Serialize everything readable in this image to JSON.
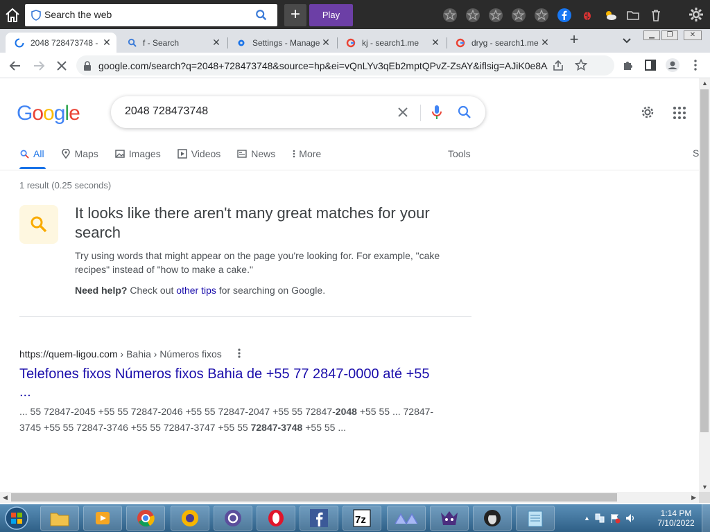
{
  "topbar": {
    "search_placeholder": "Search the web",
    "play_label": "Play",
    "new_label": "+"
  },
  "tabs": [
    {
      "title": "2048 728473748 -",
      "close": "✕",
      "favicon": "loading-spinner-icon",
      "active": true
    },
    {
      "title": "f - Search",
      "close": "✕",
      "favicon": "search-icon"
    },
    {
      "title": "Settings - Manage",
      "close": "✕",
      "favicon": "gear-icon"
    },
    {
      "title": "kj - search1.me",
      "close": "✕",
      "favicon": "google-icon"
    },
    {
      "title": "dryg - search1.me",
      "close": "✕",
      "favicon": "google-icon"
    }
  ],
  "address_bar": {
    "url": "google.com/search?q=2048+728473748&source=hp&ei=vQnLYv3qEb2mptQPvZ-ZsAY&iflsig=AJiK0e8AAA..."
  },
  "google": {
    "logo": [
      "G",
      "o",
      "o",
      "g",
      "l",
      "e"
    ],
    "logo_colors": [
      "#4285f4",
      "#ea4335",
      "#fbbc05",
      "#4285f4",
      "#34a853",
      "#ea4335"
    ],
    "query": "2048 728473748",
    "tabs": [
      {
        "label": "All",
        "icon": "search-icon"
      },
      {
        "label": "Maps",
        "icon": "map-pin-icon"
      },
      {
        "label": "Images",
        "icon": "image-icon"
      },
      {
        "label": "Videos",
        "icon": "video-icon"
      },
      {
        "label": "News",
        "icon": "news-icon"
      },
      {
        "label": "More",
        "icon": "more-vert-icon"
      }
    ],
    "tools_label": "Tools",
    "signin_edge": "S",
    "result_stats": "1 result (0.25 seconds)",
    "no_match": {
      "title": "It looks like there aren't many great matches for your search",
      "body": "Try using words that might appear on the page you're looking for. For example, \"cake recipes\" instead of \"how to make a cake.\"",
      "help_bold": "Need help?",
      "help_pre": " Check out ",
      "help_link": "other tips",
      "help_post": " for searching on Google."
    },
    "result": {
      "site": "https://quem-ligou.com",
      "breadcrumb": " › Bahia › Números fixos",
      "title": "Telefones fixos Números fixos Bahia de +55 77 2847-0000 até +55 ...",
      "snippet_1": "... 55 72847-2045 +55 55 72847-2046 +55 55 72847-2047 +55 55 72847-",
      "snippet_b1": "2048",
      "snippet_2": " +55 55 ... 72847-3745 +55 55 72847-3746 +55 55 72847-3747 +55 55 ",
      "snippet_b2": "72847-3748",
      "snippet_3": " +55 55 ..."
    }
  },
  "taskbar": {
    "clock_time": "1:14 PM",
    "clock_date": "7/10/2022",
    "apps": [
      "file-explorer-icon",
      "media-player-icon",
      "chrome-icon",
      "vpn-icon",
      "app-q-icon",
      "opera-icon",
      "facebook-icon",
      "7zip-icon",
      "app-wave-icon",
      "app-monster-icon",
      "app-anonymous-icon",
      "notepad-icon"
    ]
  },
  "colors": {
    "link": "#1a0dab",
    "accent": "#1a73e8",
    "play_button": "#6c3fa6",
    "topbar_bg": "#2b2b2b"
  }
}
